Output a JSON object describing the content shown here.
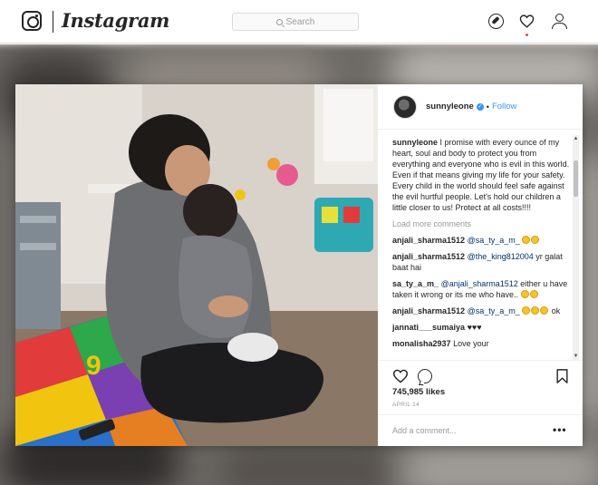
{
  "nav": {
    "brand": "Instagram",
    "search_placeholder": "Search",
    "icons": [
      "instagram-logo-icon",
      "compass-icon",
      "heart-icon",
      "profile-icon"
    ],
    "has_notification": true
  },
  "post": {
    "username": "sunnyleone",
    "follow_label": "Follow",
    "separator": "•",
    "caption_user": "sunnyleone",
    "caption_text": "I promise with every ounce of my heart, soul and body to protect you from everything and everyone who is evil in this world. Even if that means giving my life for your safety. Every child in the world should feel safe against the evil hurtful people. Let's hold our children a little closer to us! Protect at all costs!!!!",
    "load_more": "Load more comments",
    "comments": [
      {
        "user": "anjali_sharma1512",
        "mention": "@sa_ty_a_m_",
        "text": "",
        "emojis": 2
      },
      {
        "user": "anjali_sharma1512",
        "mention": "@the_king812004",
        "text": "yr galat baat hai",
        "emojis": 0
      },
      {
        "user": "sa_ty_a_m_",
        "mention": "@anjali_sharma1512",
        "text": "either u have taken it wrong or its me who have..",
        "emojis": 2
      },
      {
        "user": "anjali_sharma1512",
        "mention": "@sa_ty_a_m_",
        "text": "ok",
        "emojis": 3
      },
      {
        "user": "jannati___sumaiya",
        "mention": "",
        "text": "♥♥♥",
        "emojis": 0
      },
      {
        "user": "monalisha2937",
        "mention": "",
        "text": "Love your",
        "emojis": 0
      }
    ],
    "likes": "745,985 likes",
    "date": "APRIL 14",
    "add_comment_placeholder": "Add a comment...",
    "more_label": "•••"
  },
  "colors": {
    "link": "#3897f0",
    "text": "#262626",
    "muted": "#999999",
    "notif": "#ed4956"
  }
}
